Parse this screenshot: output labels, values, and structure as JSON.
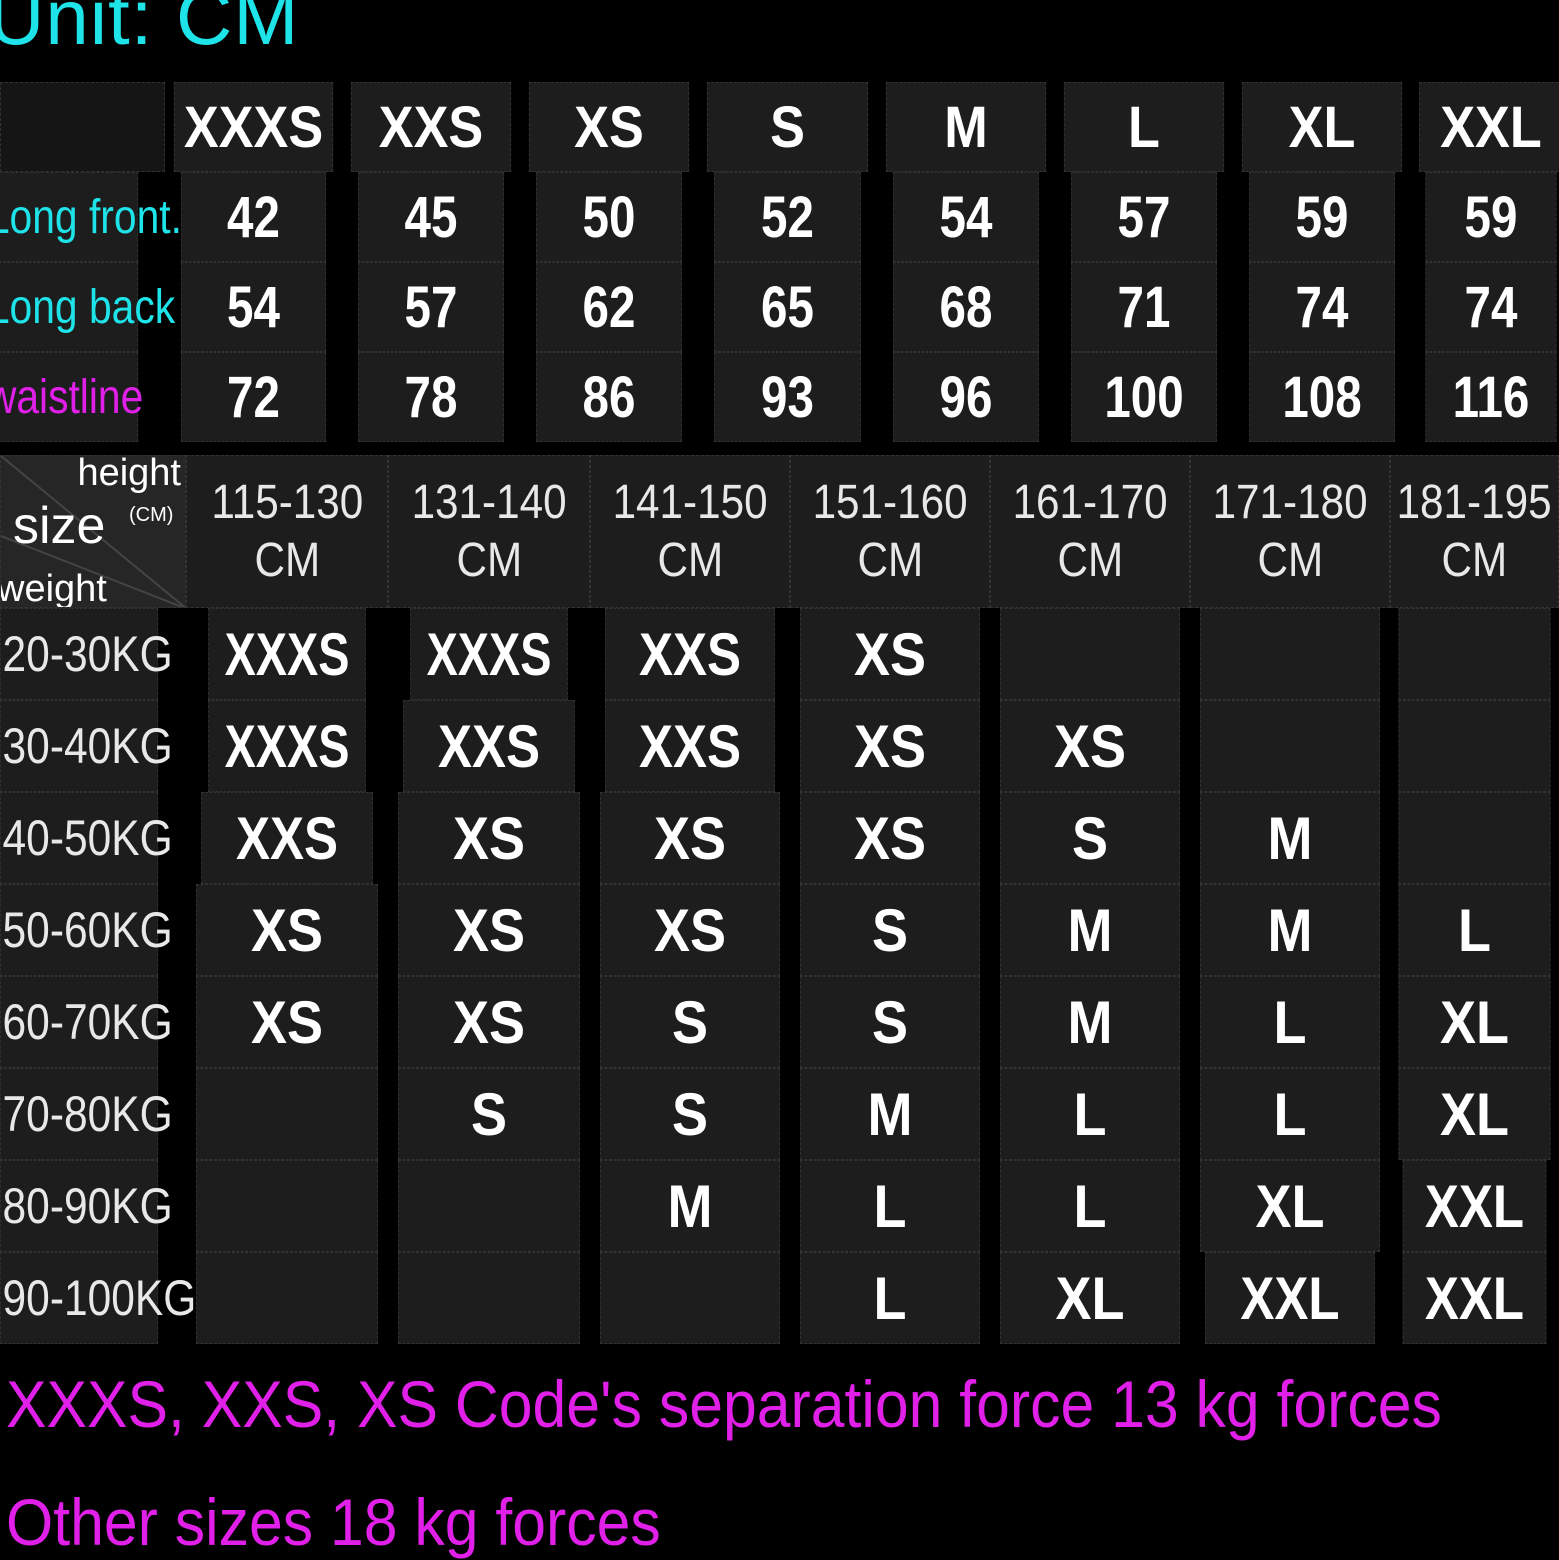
{
  "header": {
    "title": "Unit: CM"
  },
  "measurements": {
    "sizes": [
      "XXXS",
      "XXS",
      "XS",
      "S",
      "M",
      "L",
      "XL",
      "XXL"
    ],
    "rows": [
      {
        "label": "Long front.",
        "values": [
          "42",
          "45",
          "50",
          "52",
          "54",
          "57",
          "59",
          "59"
        ]
      },
      {
        "label": "Long back",
        "values": [
          "54",
          "57",
          "62",
          "65",
          "68",
          "71",
          "74",
          "74"
        ]
      },
      {
        "label": "waistline",
        "values": [
          "72",
          "78",
          "86",
          "93",
          "96",
          "100",
          "108",
          "116"
        ]
      }
    ]
  },
  "size_chart": {
    "corner": {
      "height": "height",
      "size": "size",
      "unit": "(CM)",
      "weight": "weight"
    },
    "heights": [
      {
        "range": "115-130",
        "unit": "CM"
      },
      {
        "range": "131-140",
        "unit": "CM"
      },
      {
        "range": "141-150",
        "unit": "CM"
      },
      {
        "range": "151-160",
        "unit": "CM"
      },
      {
        "range": "161-170",
        "unit": "CM"
      },
      {
        "range": "171-180",
        "unit": "CM"
      },
      {
        "range": "181-195",
        "unit": "CM"
      }
    ],
    "rows": [
      {
        "weight": "20-30KG",
        "sizes": [
          "XXXS",
          "XXXS",
          "XXS",
          "XS",
          "",
          "",
          ""
        ]
      },
      {
        "weight": "30-40KG",
        "sizes": [
          "XXXS",
          "XXS",
          "XXS",
          "XS",
          "XS",
          "",
          ""
        ]
      },
      {
        "weight": "40-50KG",
        "sizes": [
          "XXS",
          "XS",
          "XS",
          "XS",
          "S",
          "M",
          ""
        ]
      },
      {
        "weight": "50-60KG",
        "sizes": [
          "XS",
          "XS",
          "XS",
          "S",
          "M",
          "M",
          "L"
        ]
      },
      {
        "weight": "60-70KG",
        "sizes": [
          "XS",
          "XS",
          "S",
          "S",
          "M",
          "L",
          "XL"
        ]
      },
      {
        "weight": "70-80KG",
        "sizes": [
          "",
          "S",
          "S",
          "M",
          "L",
          "L",
          "XL"
        ]
      },
      {
        "weight": "80-90KG",
        "sizes": [
          "",
          "",
          "M",
          "L",
          "L",
          "XL",
          "XXL"
        ]
      },
      {
        "weight": "90-100KG",
        "sizes": [
          "",
          "",
          "",
          "L",
          "XL",
          "XXL",
          "XXL"
        ]
      }
    ]
  },
  "notes": {
    "line1": "XXXS, XXS, XS Code's separation force 13 kg forces",
    "line2": "Other sizes 18 kg forces"
  },
  "colors": {
    "accent_cyan": "#1ee3e8",
    "accent_magenta": "#e020e8",
    "cell_bg": "#1d1d1d"
  }
}
